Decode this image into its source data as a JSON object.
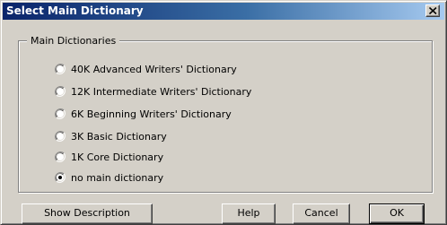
{
  "window": {
    "title": "Select Main Dictionary",
    "close_glyph": "×"
  },
  "group": {
    "label": "Main Dictionaries"
  },
  "options": [
    {
      "label": "40K Advanced Writers' Dictionary",
      "selected": false
    },
    {
      "label": "12K Intermediate Writers' Dictionary",
      "selected": false
    },
    {
      "label": "6K Beginning Writers' Dictionary",
      "selected": false
    },
    {
      "label": "3K Basic Dictionary",
      "selected": false
    },
    {
      "label": "1K Core Dictionary",
      "selected": false
    },
    {
      "label": "no main dictionary",
      "selected": true
    }
  ],
  "buttons": {
    "show_description": "Show Description",
    "help": "Help",
    "cancel": "Cancel",
    "ok": "OK"
  },
  "colors": {
    "face": "#d4d0c8",
    "title_start": "#0a246a",
    "title_end": "#a6caf0"
  }
}
